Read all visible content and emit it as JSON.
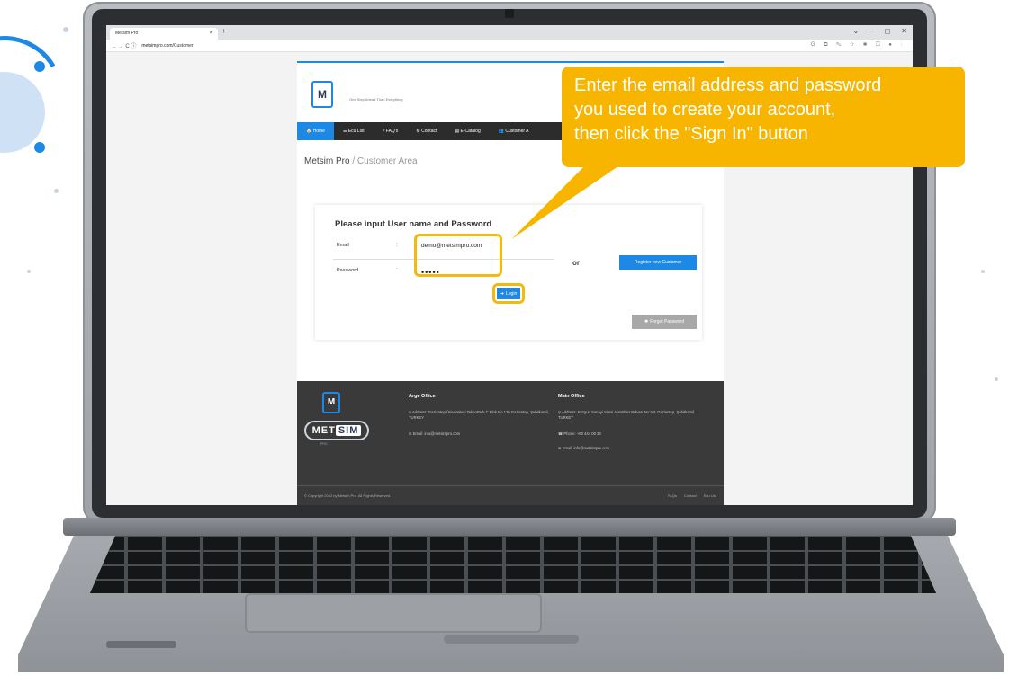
{
  "browser": {
    "tab_title": "Metsim Pro",
    "tab_close": "×",
    "new_tab": "+",
    "window_controls": [
      "⌄",
      "–",
      "◻",
      "✕"
    ],
    "url_host": "metsimpro.com",
    "url_path": "/Customer",
    "nav_glyphs": "←  →  C  ⓘ",
    "extension_glyphs": "G ⧉ ✎ ☆ ✱ ☐ ●  ⋮"
  },
  "site": {
    "logo_text": "M",
    "tagline": "One Step Ahead Than Everything",
    "nav": [
      {
        "label": "🏠 Home",
        "active": true
      },
      {
        "label": "☰ Ecu List",
        "active": false
      },
      {
        "label": "? FAQ's",
        "active": false
      },
      {
        "label": "⚙ Contact",
        "active": false
      },
      {
        "label": "▤ E-Catalog",
        "active": false
      },
      {
        "label": "👥 Customer A",
        "active": false
      }
    ],
    "breadcrumb_main": "Metsim Pro",
    "breadcrumb_sep": " / ",
    "breadcrumb_sub": "Customer Area"
  },
  "login": {
    "heading": "Please input User name and Password",
    "email_label": "Email",
    "password_label": "Password",
    "colon": ":",
    "email_value": "demo@metsimpro.com",
    "password_value": "•••••",
    "or": "or",
    "register_label": "Register new Customer",
    "login_label": "Login",
    "forgot_label": "Forgot Password"
  },
  "footer": {
    "logo_text": "M",
    "brand_met": "MET",
    "brand_sim": "SIM",
    "brand_sub": "PRO",
    "arge_title": "Arge Office",
    "arge_address": "Address: Gaziantep Üniversitesi TeknoPark C Blok No 120 Gaziantep, Şehitkamil, TURKEY",
    "arge_email": "Email: info@metsimpro.com",
    "main_title": "Main Office",
    "main_address": "Address: Kuzgun Sanayi Sitesi Atatürkler Bulvarı No:101 Gaziantep, Şehitkamil, TURKEY",
    "main_phone": "Phone: +90 444 00 38",
    "main_email": "Email: info@metsimpro.com",
    "copyright": "© Copyright 2022 by Metsim Pro. All Rights Reserved.",
    "bottom_links": [
      "FAQs",
      "Contact",
      "Ecu List"
    ]
  },
  "callout": {
    "line1": "Enter the email address and password",
    "line2": "you used to create your account,",
    "line3": " then click the \"Sign In\" button"
  },
  "colors": {
    "accent": "#1e88e5",
    "highlight": "#f7b500",
    "footer_bg": "#3a3a3a"
  }
}
